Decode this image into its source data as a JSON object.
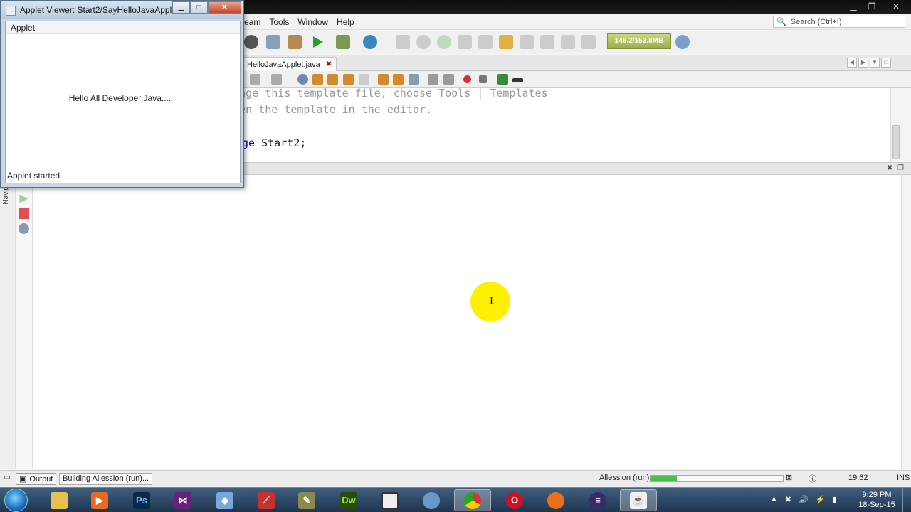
{
  "ide": {
    "menus": [
      "eam",
      "Tools",
      "Window",
      "Help"
    ],
    "search_placeholder": "Search (Ctrl+I)",
    "memory": "146.2/153.8MB",
    "tab_label": "HelloJavaApplet.java",
    "code_lines": [
      {
        "comment": " change this template file, choose Tools | Templates"
      },
      {
        "comment": "d open the template in the editor."
      },
      {
        "keyword": "ge",
        "rest": " Start2;"
      }
    ],
    "status": {
      "output_label": "Output",
      "building": "Building Allession (run)...",
      "run_label": "Allession (run)",
      "progress": 0.2,
      "position": "19:62",
      "mode": "INS"
    },
    "navigator_label": "Navig"
  },
  "applet": {
    "title": "Applet Viewer: Start2/SayHelloJavaApple...",
    "menu": "Applet",
    "message": "Hello All Developer Java....",
    "status": "Applet started."
  },
  "taskbar": {
    "apps": [
      "file-explorer",
      "media-player",
      "photoshop",
      "visual-studio",
      "virtualbox",
      "filezilla",
      "tools",
      "dreamweaver",
      "window",
      "network",
      "chrome",
      "opera",
      "firefox",
      "eclipse",
      "java"
    ],
    "time": "9:29 PM",
    "date": "18-Sep-15"
  },
  "colors": {
    "accent": "#1b6bb8",
    "cursor_highlight": "#ffef00",
    "progress": "#4ac04a"
  }
}
